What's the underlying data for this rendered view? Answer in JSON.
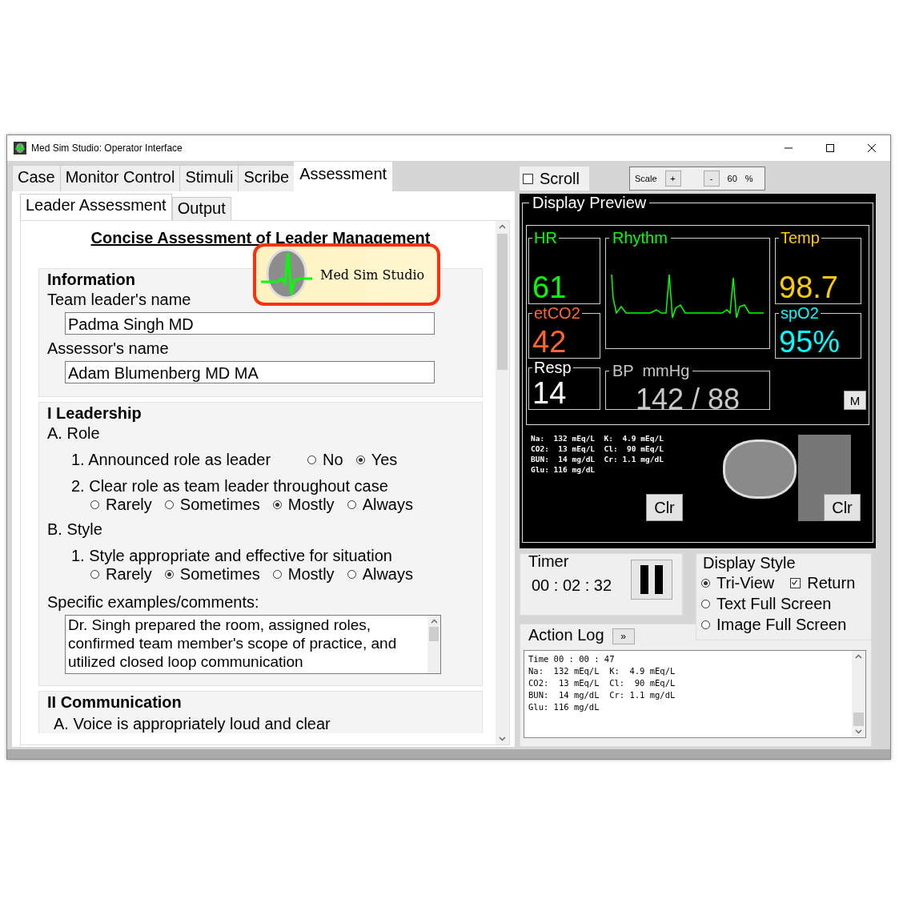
{
  "window": {
    "title": "Med Sim Studio: Operator Interface"
  },
  "tabs": [
    {
      "label": "Case",
      "selected": false
    },
    {
      "label": "Monitor Control",
      "selected": false
    },
    {
      "label": "Stimuli",
      "selected": false
    },
    {
      "label": "Scribe",
      "selected": false
    },
    {
      "label": "Assessment",
      "selected": true
    }
  ],
  "sub_tabs": [
    {
      "label": "Leader Assessment",
      "selected": true
    },
    {
      "label": "Output",
      "selected": false
    }
  ],
  "form": {
    "title": "Concise Assessment of Leader Management",
    "logo": {
      "text": "Med Sim Studio"
    },
    "information": {
      "heading": "Information",
      "fields": [
        {
          "label": "Team leader's name",
          "value": "Padma Singh MD"
        },
        {
          "label": "Assessor's name",
          "value": "Adam Blumenberg MD MA"
        }
      ]
    },
    "leadership": {
      "heading": "I Leadership",
      "groups": [
        {
          "label": "A. Role",
          "items": [
            {
              "kind": "inline",
              "question": "1. Announced role as leader",
              "options": [
                {
                  "label": "No",
                  "selected": false
                },
                {
                  "label": "Yes",
                  "selected": true
                }
              ]
            },
            {
              "kind": "stacked",
              "question": "2. Clear role as team leader throughout case",
              "options": [
                {
                  "label": "Rarely",
                  "selected": false
                },
                {
                  "label": "Sometimes",
                  "selected": false
                },
                {
                  "label": "Mostly",
                  "selected": true
                },
                {
                  "label": "Always",
                  "selected": false
                }
              ]
            }
          ]
        },
        {
          "label": "B. Style",
          "items": [
            {
              "kind": "stacked",
              "question": "1. Style appropriate and effective for situation",
              "options": [
                {
                  "label": "Rarely",
                  "selected": false
                },
                {
                  "label": "Sometimes",
                  "selected": true
                },
                {
                  "label": "Mostly",
                  "selected": false
                },
                {
                  "label": "Always",
                  "selected": false
                }
              ]
            }
          ]
        }
      ],
      "comments_label": "Specific examples/comments:",
      "comments": "Dr. Singh prepared the room, assigned roles, confirmed team member's scope of practice, and utilized closed loop communication"
    },
    "communication": {
      "heading": "II Communication",
      "items": [
        "A. Voice is appropriately loud and clear"
      ]
    }
  },
  "toolbar": {
    "scroll": {
      "label": "Scroll",
      "checked": false
    },
    "scale": {
      "label": "Scale",
      "plus": "+",
      "minus": "-",
      "value": "60",
      "unit": "%"
    }
  },
  "display_preview": {
    "title": "Display Preview",
    "vitals": [
      {
        "label": "HR",
        "value": "61",
        "color": "#00ff00"
      },
      {
        "label": "Temp",
        "value": "98.7",
        "color": "#ffcc00"
      },
      {
        "label": "etCO2",
        "value": "42",
        "color": "#ff6633"
      },
      {
        "label": "spO2",
        "value": "95%",
        "color": "#00ffff"
      },
      {
        "label": "Resp",
        "value": "14",
        "color": "#ffffff"
      }
    ],
    "rhythm": {
      "label": "Rhythm"
    },
    "bp": {
      "label": "BP  mmHg",
      "value": "142 / 88"
    },
    "mode_button": "M",
    "labs": [
      "Na:  132 mEq/L  K:  4.9 mEq/L",
      "CO2:  13 mEq/L  Cl:  90 mEq/L",
      "BUN:  14 mg/dL  Cr: 1.1 mg/dL",
      "Glu: 116 mg/dL"
    ],
    "clear_buttons": [
      "Clr",
      "Clr"
    ]
  },
  "timer": {
    "title": "Timer",
    "time": "00 : 02 : 32"
  },
  "display_style": {
    "title": "Display Style",
    "options": [
      {
        "label": "Tri-View",
        "selected": true
      },
      {
        "label": "Text Full Screen",
        "selected": false
      },
      {
        "label": "Image Full Screen",
        "selected": false
      }
    ],
    "return_option": {
      "label": "Return",
      "checked": true
    }
  },
  "action_log": {
    "title": "Action Log",
    "expand_button": "»",
    "lines": [
      "Time 00 : 00 : 47",
      "Na:  132 mEq/L  K:  4.9 mEq/L",
      "CO2:  13 mEq/L  Cl:  90 mEq/L",
      "BUN:  14 mg/dL  Cr: 1.1 mg/dL",
      "Glu: 116 mg/dL"
    ]
  }
}
